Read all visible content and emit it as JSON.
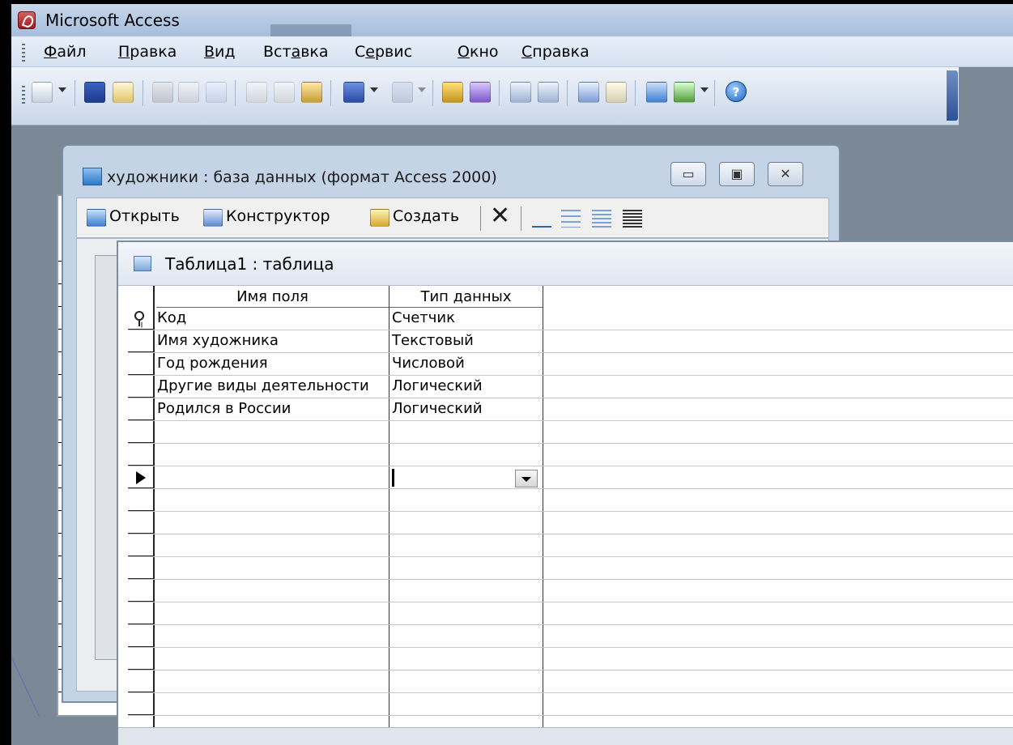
{
  "app": {
    "title": "Microsoft Access",
    "menu": [
      "Файл",
      "Правка",
      "Вид",
      "Вставка",
      "Сервис",
      "Окно",
      "Справка"
    ],
    "menu_accel": [
      "Ф",
      "П",
      "В",
      "а",
      "е",
      "О",
      "С"
    ]
  },
  "toolbar": {
    "icons": [
      "view-icon",
      "save-icon",
      "search-icon",
      "print-icon",
      "print-preview-icon",
      "spelling-icon",
      "cut-icon",
      "copy-icon",
      "paste-icon",
      "undo-icon",
      "redo-icon",
      "primary-key-icon",
      "builder-icon",
      "insert-rows-icon",
      "delete-rows-icon",
      "properties-icon",
      "build-icon",
      "database-window-icon",
      "new-object-icon",
      "help-icon"
    ],
    "help_label": "?"
  },
  "db_window": {
    "title": "художники : база данных (формат Access 2000)",
    "open_label": "Открыть",
    "design_label": "Конструктор",
    "create_label": "Создать",
    "delete_glyph": "✕",
    "minimize_glyph": "▭",
    "restore_glyph": "▣",
    "close_glyph": "✕"
  },
  "table_window": {
    "title": "Таблица1 : таблица",
    "columns": [
      "Имя поля",
      "Тип данных"
    ],
    "rows": [
      {
        "field": "Код",
        "type": "Счетчик",
        "primary_key": true
      },
      {
        "field": "Имя художника",
        "type": "Текстовый"
      },
      {
        "field": "Год рождения",
        "type": "Числовой"
      },
      {
        "field": "Другие виды деятельности",
        "type": "Логический"
      },
      {
        "field": "Родился в России",
        "type": "Логический"
      },
      {
        "field": "",
        "type": ""
      },
      {
        "field": "",
        "type": ""
      },
      {
        "field": "",
        "type": "",
        "current": true
      },
      {
        "field": "",
        "type": ""
      },
      {
        "field": "",
        "type": ""
      },
      {
        "field": "",
        "type": ""
      },
      {
        "field": "",
        "type": ""
      },
      {
        "field": "",
        "type": ""
      },
      {
        "field": "",
        "type": ""
      },
      {
        "field": "",
        "type": ""
      },
      {
        "field": "",
        "type": ""
      },
      {
        "field": "",
        "type": ""
      },
      {
        "field": "",
        "type": ""
      },
      {
        "field": "",
        "type": ""
      }
    ]
  },
  "colors": {
    "titlebar": "#b3c8e3",
    "workspace": "#7b8895",
    "db_window": "#c4d3e6",
    "background": "#000000"
  }
}
